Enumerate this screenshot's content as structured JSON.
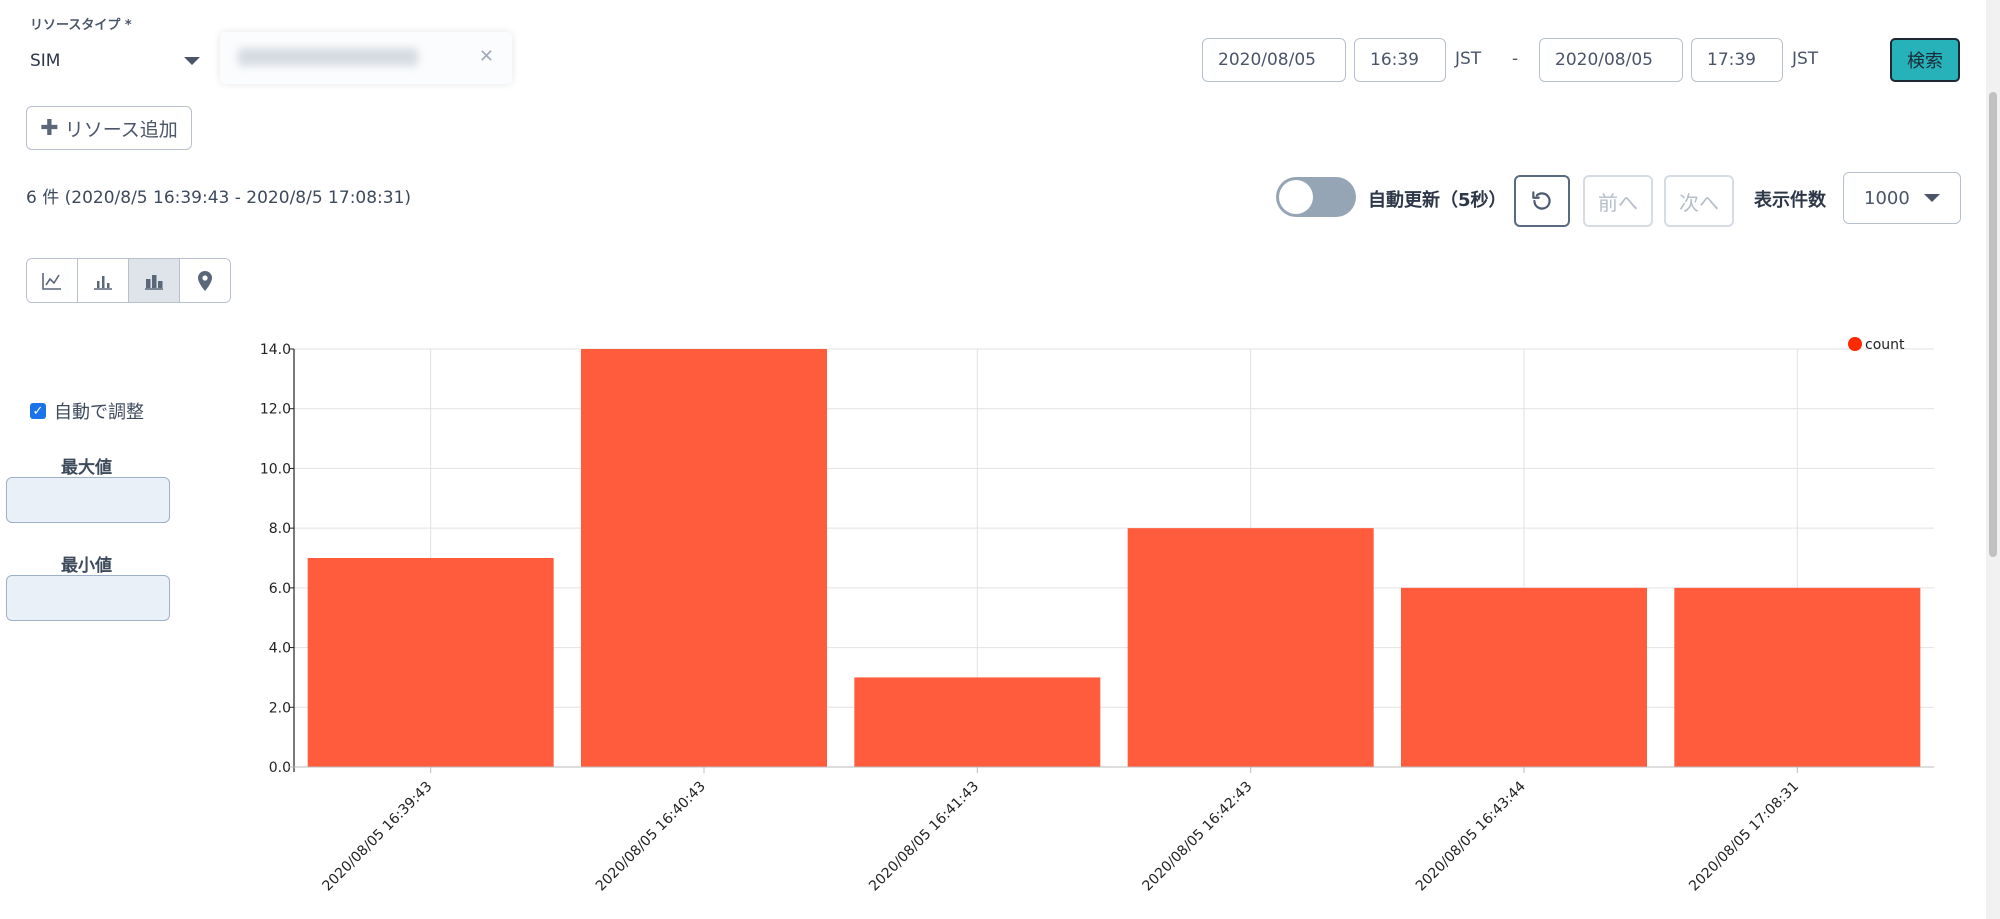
{
  "resource_type": {
    "label": "リソースタイプ *",
    "selected": "SIM"
  },
  "add_resource_label": "リソース追加",
  "date_range": {
    "start_date": "2020/08/05",
    "start_time": "16:39",
    "start_tz": "JST",
    "separator": "-",
    "end_date": "2020/08/05",
    "end_time": "17:39",
    "end_tz": "JST",
    "search_label": "検索"
  },
  "result_summary": "6 件 (2020/8/5 16:39:43 - 2020/8/5 17:08:31)",
  "toolbar": {
    "auto_update_label": "自動更新（5秒）",
    "auto_update_on": false,
    "prev_label": "前へ",
    "next_label": "次へ",
    "per_page_label": "表示件数",
    "per_page_value": "1000"
  },
  "chart_types": [
    "line-chart-icon",
    "bar-chart-icon",
    "stacked-bar-icon",
    "map-pin-icon"
  ],
  "axis_controls": {
    "auto_adjust_label": "自動で調整",
    "auto_adjust_checked": true,
    "max_label": "最大値",
    "min_label": "最小値"
  },
  "colors": {
    "bar": "#ff5c3d",
    "accent": "#26b2b8"
  },
  "chart_data": {
    "type": "bar",
    "categories": [
      "2020/08/05 16:39:43",
      "2020/08/05 16:40:43",
      "2020/08/05 16:41:43",
      "2020/08/05 16:42:43",
      "2020/08/05 16:43:44",
      "2020/08/05 17:08:31"
    ],
    "series": [
      {
        "name": "count",
        "values": [
          7,
          14,
          3,
          8,
          6,
          6
        ]
      }
    ],
    "ylim": [
      0,
      14
    ],
    "yticks": [
      "0.0",
      "2.0",
      "4.0",
      "6.0",
      "8.0",
      "10.0",
      "12.0",
      "14.0"
    ],
    "grid": true,
    "legend": "top-right"
  }
}
